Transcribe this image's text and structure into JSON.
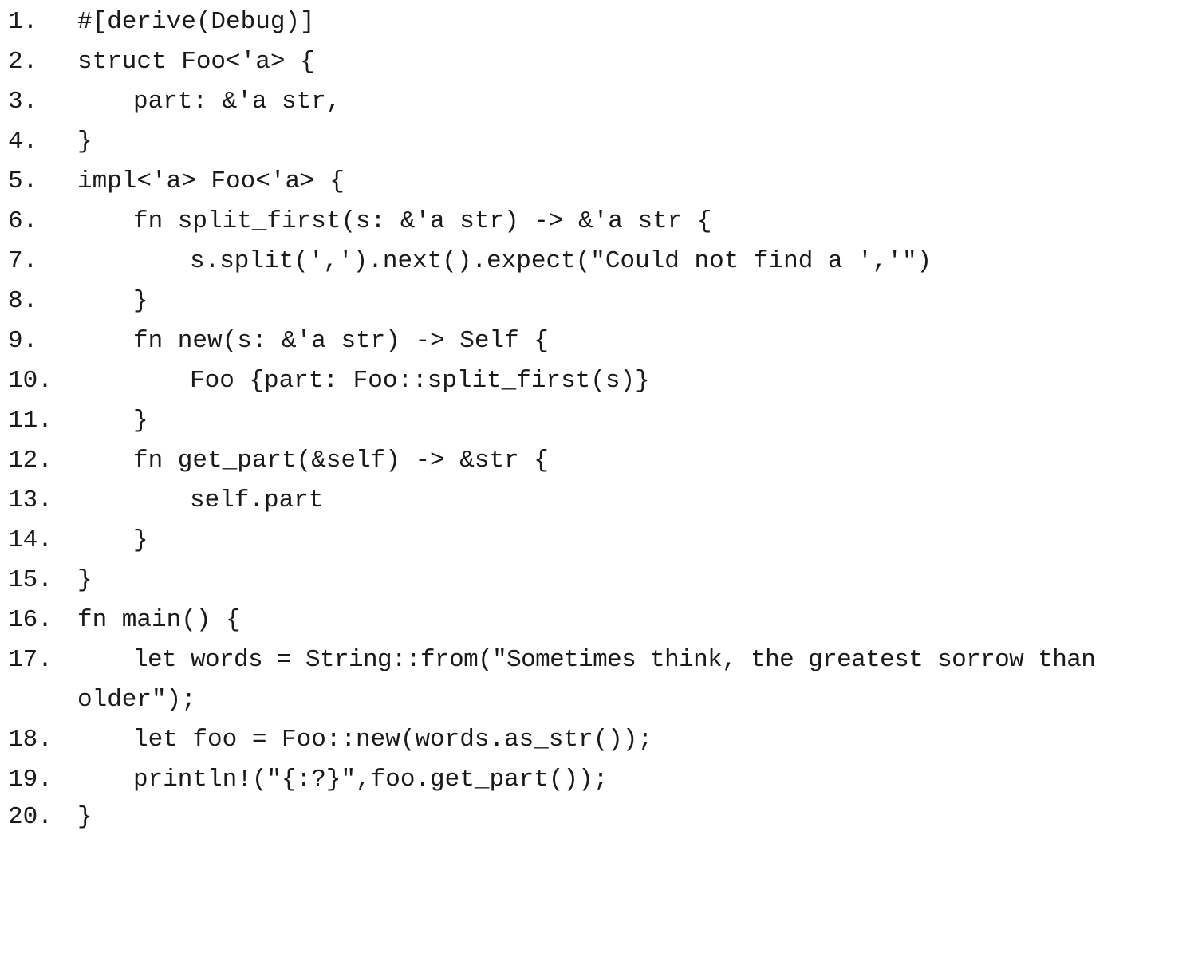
{
  "listing": {
    "lines": [
      {
        "num": "1.",
        "code": "#[derive(Debug)]"
      },
      {
        "num": "2.",
        "code": "struct Foo<'a> {"
      },
      {
        "num": "3.",
        "code": "part: &'a str,"
      },
      {
        "num": "4.",
        "code": "}"
      },
      {
        "num": "5.",
        "code": "impl<'a> Foo<'a> {"
      },
      {
        "num": "6.",
        "code": "fn split_first(s: &'a str) -> &'a str {"
      },
      {
        "num": "7.",
        "code": "s.split(',').next().expect(\"Could not find a ','\")"
      },
      {
        "num": "8.",
        "code": "}"
      },
      {
        "num": "9.",
        "code": "fn new(s: &'a str) -> Self {"
      },
      {
        "num": "10.",
        "code": "Foo {part: Foo::split_first(s)}"
      },
      {
        "num": "11.",
        "code": "}"
      },
      {
        "num": "12.",
        "code": "fn get_part(&self) -> &str {"
      },
      {
        "num": "13.",
        "code": "self.part"
      },
      {
        "num": "14.",
        "code": "}"
      },
      {
        "num": "15.",
        "code": "}"
      },
      {
        "num": "16.",
        "code": "fn main() {"
      },
      {
        "num": "17.",
        "code": "let words = String::from(\"Sometimes think, the greatest sorrow than"
      },
      {
        "num": "",
        "code": "older\");"
      },
      {
        "num": "18.",
        "code": "let foo = Foo::new(words.as_str());"
      },
      {
        "num": "19.",
        "code": "println!(\"{:?}\",foo.get_part());"
      },
      {
        "num": "20.",
        "code": "}"
      }
    ]
  }
}
